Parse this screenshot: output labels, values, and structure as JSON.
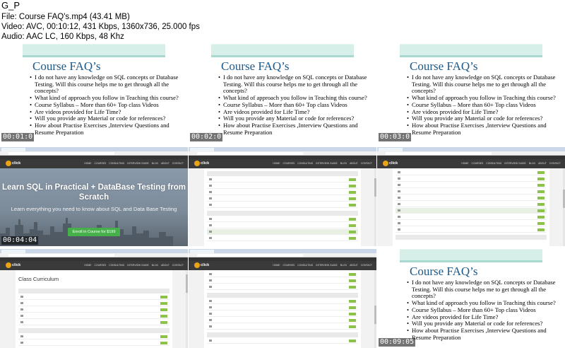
{
  "header": {
    "title": "G_P",
    "file_line": "File: Course FAQ's.mp4 (43.41 MB)",
    "video_line": "Video: AVC, 00:10:12, 431 Kbps, 1360x736, 25.000 fps",
    "audio_line": "Audio: AAC LC, 160 Kbps, 48 Khz"
  },
  "slide": {
    "title": "Course FAQ’s",
    "bullets": [
      "I do not have any knowledge on SQL concepts  or Database Testing. Will this course helps me to get through all the concepts?",
      "What kind of approach you follow in Teaching this course?",
      "Course Syllabus – More than 60+ Top class Videos",
      "Are videos provided for Life Time?",
      "Will you provide any Material or code for references?",
      "How about Practise Exercises ,Interview Questions and Resume Preparation"
    ]
  },
  "timestamps": [
    "00:01:0",
    "00:02:0",
    "00:03:0",
    "00:04:04",
    "00:09:05"
  ],
  "site": {
    "logo": "click",
    "nav": [
      "HOME",
      "COURSES",
      "CONSULTING",
      "INTERVIEW GUIDE",
      "BLOG",
      "ABOUT",
      "CONTACT"
    ],
    "hero_title": "Learn SQL in Practical + DataBase Testing from Scratch",
    "hero_sub": "Learn everything you need to know about SQL and Data Base Testing",
    "enroll": "Enroll in Course for $199",
    "curriculum_title": "Class Curriculum"
  }
}
